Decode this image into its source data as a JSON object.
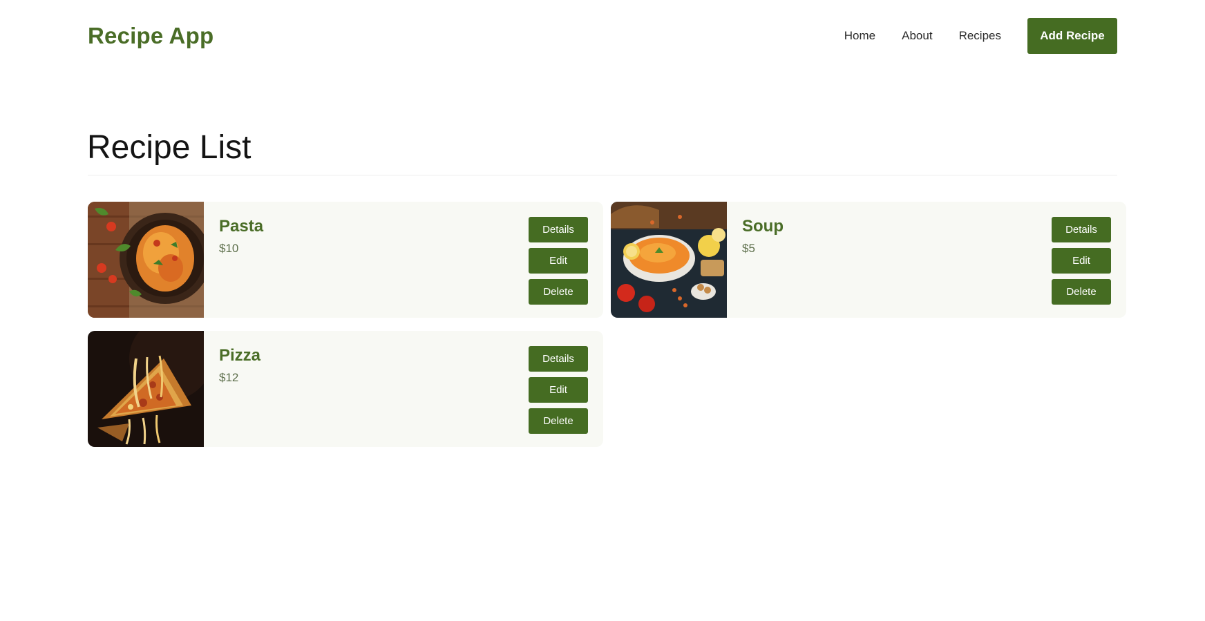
{
  "header": {
    "brand": "Recipe App",
    "nav": [
      {
        "label": "Home"
      },
      {
        "label": "About"
      },
      {
        "label": "Recipes"
      }
    ],
    "add_button": "Add Recipe"
  },
  "main": {
    "title": "Recipe List",
    "recipes": [
      {
        "name": "Pasta",
        "price": "$10",
        "image": "pasta-photo",
        "actions": {
          "details": "Details",
          "edit": "Edit",
          "delete": "Delete"
        }
      },
      {
        "name": "Soup",
        "price": "$5",
        "image": "soup-photo",
        "actions": {
          "details": "Details",
          "edit": "Edit",
          "delete": "Delete"
        }
      },
      {
        "name": "Pizza",
        "price": "$12",
        "image": "pizza-photo",
        "actions": {
          "details": "Details",
          "edit": "Edit",
          "delete": "Delete"
        }
      }
    ]
  },
  "colors": {
    "brand": "#4a6d27",
    "button": "#456c22",
    "card_bg": "#f8f9f4"
  }
}
